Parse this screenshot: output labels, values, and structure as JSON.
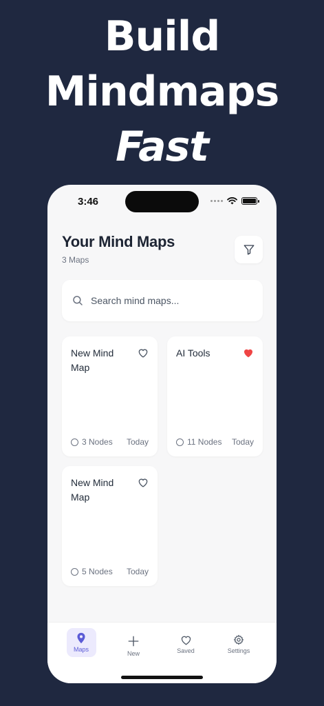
{
  "headline": {
    "line1": "Build",
    "line2": "Mindmaps",
    "line3": "Fast"
  },
  "status_bar": {
    "time": "3:46"
  },
  "header": {
    "title": "Your Mind Maps",
    "count": "3 Maps"
  },
  "search": {
    "placeholder": "Search mind maps..."
  },
  "cards": [
    {
      "title": "New Mind Map",
      "nodes": "3 Nodes",
      "date": "Today",
      "favorite": false
    },
    {
      "title": "AI Tools",
      "nodes": "11 Nodes",
      "date": "Today",
      "favorite": true
    },
    {
      "title": "New Mind Map",
      "nodes": "5 Nodes",
      "date": "Today",
      "favorite": false
    }
  ],
  "tabbar": {
    "items": [
      {
        "label": "Maps",
        "icon": "map-pin-icon",
        "active": true
      },
      {
        "label": "New",
        "icon": "plus-icon",
        "active": false
      },
      {
        "label": "Saved",
        "icon": "heart-icon",
        "active": false
      },
      {
        "label": "Settings",
        "icon": "gear-icon",
        "active": false
      }
    ]
  },
  "colors": {
    "background": "#1f2840",
    "accent": "#5b5bd6",
    "favorite": "#ef4444"
  }
}
